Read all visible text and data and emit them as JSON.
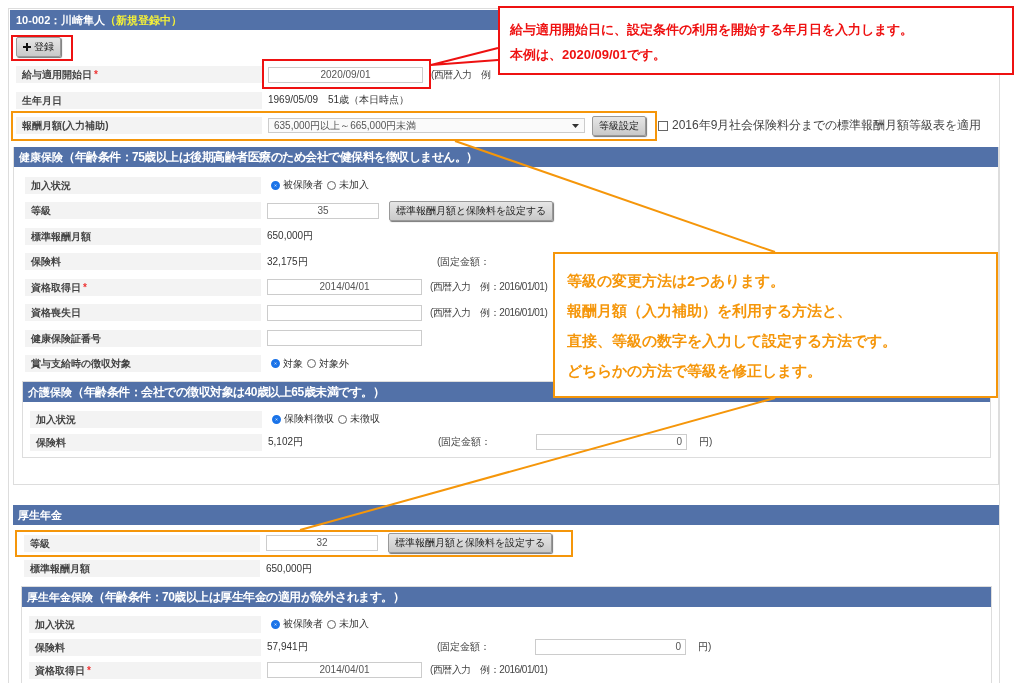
{
  "header": {
    "title": "10-002：川崎隼人",
    "status": "（新規登録中）"
  },
  "register_button": {
    "label": "登録"
  },
  "top_rows": [
    {
      "kind": "date",
      "label": "給与適用開始日",
      "required_mark": "*",
      "value": "2020/09/01",
      "hint": "(西暦入力　例"
    },
    {
      "kind": "text",
      "label": "生年月日",
      "value": "1969/05/09　51歳（本日時点）"
    },
    {
      "kind": "select",
      "label": "報酬月額(入力補助)",
      "value": "635,000円以上～665,000円未満",
      "button": "等級設定",
      "checkbox": {
        "checked": false,
        "label": "2016年9月社会保険料分までの標準報酬月額等級表を適用"
      }
    }
  ],
  "sections": [
    {
      "title": "健康保険",
      "note": "（年齢条件：75歳以上は後期高齢者医療のため会社で健保料を徴収しません。）",
      "rows": [
        {
          "kind": "radio",
          "label": "加入状況",
          "options": [
            {
              "label": "被保険者",
              "selected": true
            },
            {
              "label": "未加入",
              "selected": false
            }
          ]
        },
        {
          "kind": "grade",
          "label": "等級",
          "value": "35",
          "button": "標準報酬月額と保険料を設定する"
        },
        {
          "kind": "text",
          "label": "標準報酬月額",
          "value": "650,000円"
        },
        {
          "kind": "fee",
          "label": "保険料",
          "value": "32,175円",
          "fixed_label": "(固定金額："
        },
        {
          "kind": "date",
          "label": "資格取得日",
          "required_mark": "*",
          "value": "2014/04/01",
          "hint": "(西暦入力　例：2016/01/01)"
        },
        {
          "kind": "date",
          "label": "資格喪失日",
          "hint": "(西暦入力　例：2016/01/01)"
        },
        {
          "kind": "date",
          "label": "健康保険証番号"
        },
        {
          "kind": "radio",
          "label": "賞与支給時の徴収対象",
          "options": [
            {
              "label": "対象",
              "selected": true
            },
            {
              "label": "対象外",
              "selected": false
            }
          ]
        }
      ],
      "subsection": {
        "title": "介護保険",
        "note": "（年齢条件：会社での徴収対象は40歳以上65歳未満です。）",
        "rows": [
          {
            "kind": "radio",
            "label": "加入状況",
            "options": [
              {
                "label": "保険料徴収",
                "selected": true
              },
              {
                "label": "未徴収",
                "selected": false
              }
            ]
          },
          {
            "kind": "fee",
            "label": "保険料",
            "value": "5,102円",
            "fixed_label": "(固定金額：",
            "fixed_value": "0",
            "unit": "円)"
          }
        ]
      }
    },
    {
      "title": "厚生年金",
      "rows": [
        {
          "kind": "grade",
          "label": "等級",
          "value": "32",
          "button": "標準報酬月額と保険料を設定する"
        },
        {
          "kind": "text",
          "label": "標準報酬月額",
          "value": "650,000円"
        }
      ],
      "subsection": {
        "title": "厚生年金保険",
        "note": "（年齢条件：70歳以上は厚生年金の適用が除外されます。）",
        "rows": [
          {
            "kind": "radio",
            "label": "加入状況",
            "options": [
              {
                "label": "被保険者",
                "selected": true
              },
              {
                "label": "未加入",
                "selected": false
              }
            ]
          },
          {
            "kind": "fee",
            "label": "保険料",
            "value": "57,941円",
            "fixed_label": "(固定金額：",
            "fixed_value": "0",
            "unit": "円)"
          },
          {
            "kind": "date",
            "label": "資格取得日",
            "required_mark": "*",
            "value": "2014/04/01",
            "hint": "(西暦入力　例：2016/01/01)"
          }
        ]
      }
    }
  ],
  "callouts": [
    {
      "color": "#ee1111",
      "lines": [
        "給与適用開始日に、設定条件の利用を開始する年月日を入力します。",
        "本例は、2020/09/01です。"
      ]
    },
    {
      "color": "#f5960a",
      "lines": [
        "等級の変更方法は2つあります。",
        "報酬月額（入力補助）を利用する方法と、",
        "直接、等級の数字を入力して設定する方法です。",
        "どちらかの方法で等級を修正します。"
      ]
    }
  ]
}
